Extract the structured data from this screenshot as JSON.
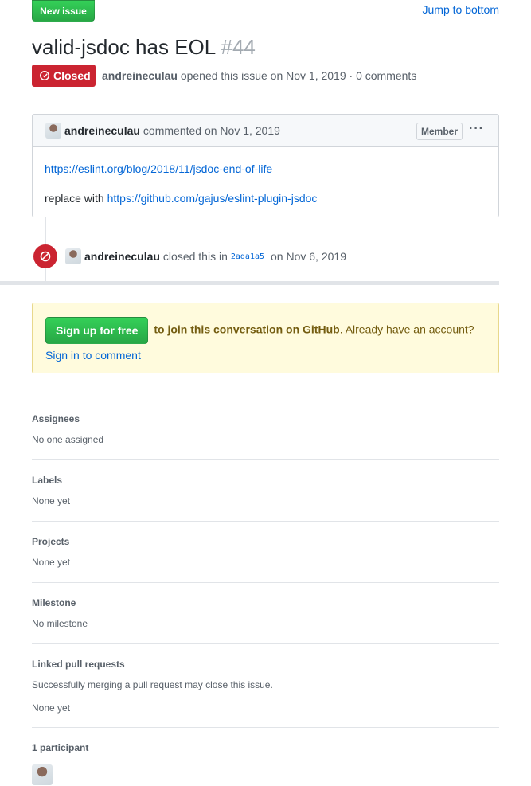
{
  "header": {
    "new_issue_label": "New issue",
    "jump_label": "Jump to bottom"
  },
  "issue": {
    "title": "valid-jsdoc has EOL",
    "number": "#44",
    "state": "Closed",
    "author": "andreineculau",
    "meta": "opened this issue on Nov 1, 2019 · 0 comments"
  },
  "comment": {
    "author": "andreineculau",
    "when": "commented on Nov 1, 2019",
    "badge": "Member",
    "more": "···",
    "link1": "https://eslint.org/blog/2018/11/jsdoc-end-of-life",
    "replace_prefix": "replace with",
    "link2": "https://github.com/gajus/eslint-plugin-jsdoc"
  },
  "event": {
    "author": "andreineculau",
    "action": "closed this in",
    "sha": "2ada1a5",
    "when": "on Nov 6, 2019"
  },
  "signup": {
    "button": "Sign up for free",
    "join_text": "to join this conversation on GitHub",
    "account_text": ". Already have an account?",
    "signin_link": "Sign in to comment"
  },
  "sidebar": {
    "assignees": {
      "heading": "Assignees",
      "value": "No one assigned"
    },
    "labels": {
      "heading": "Labels",
      "value": "None yet"
    },
    "projects": {
      "heading": "Projects",
      "value": "None yet"
    },
    "milestone": {
      "heading": "Milestone",
      "value": "No milestone"
    },
    "linked": {
      "heading": "Linked pull requests",
      "note": "Successfully merging a pull request may close this issue.",
      "value": "None yet"
    },
    "participants": {
      "heading": "1 participant"
    }
  },
  "colors": {
    "closed_red": "#cb2431",
    "green": "#28a745",
    "link_blue": "#0366d6"
  }
}
